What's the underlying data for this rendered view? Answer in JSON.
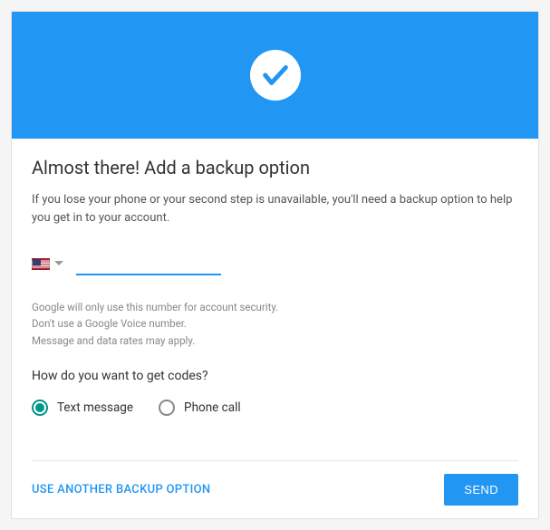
{
  "header": {
    "title": "Almost there! Add a backup option",
    "description": "If you lose your phone or your second step is unavailable, you'll need a backup option to help you get in to your account."
  },
  "phone": {
    "country_code": "US",
    "value": ""
  },
  "disclaimers": {
    "line1": "Google will only use this number for account security.",
    "line2": "Don't use a Google Voice number.",
    "line3": "Message and data rates may apply."
  },
  "delivery": {
    "question": "How do you want to get codes?",
    "options": {
      "text": "Text message",
      "call": "Phone call"
    },
    "selected": "text"
  },
  "actions": {
    "alternate": "USE ANOTHER BACKUP OPTION",
    "submit": "SEND"
  }
}
